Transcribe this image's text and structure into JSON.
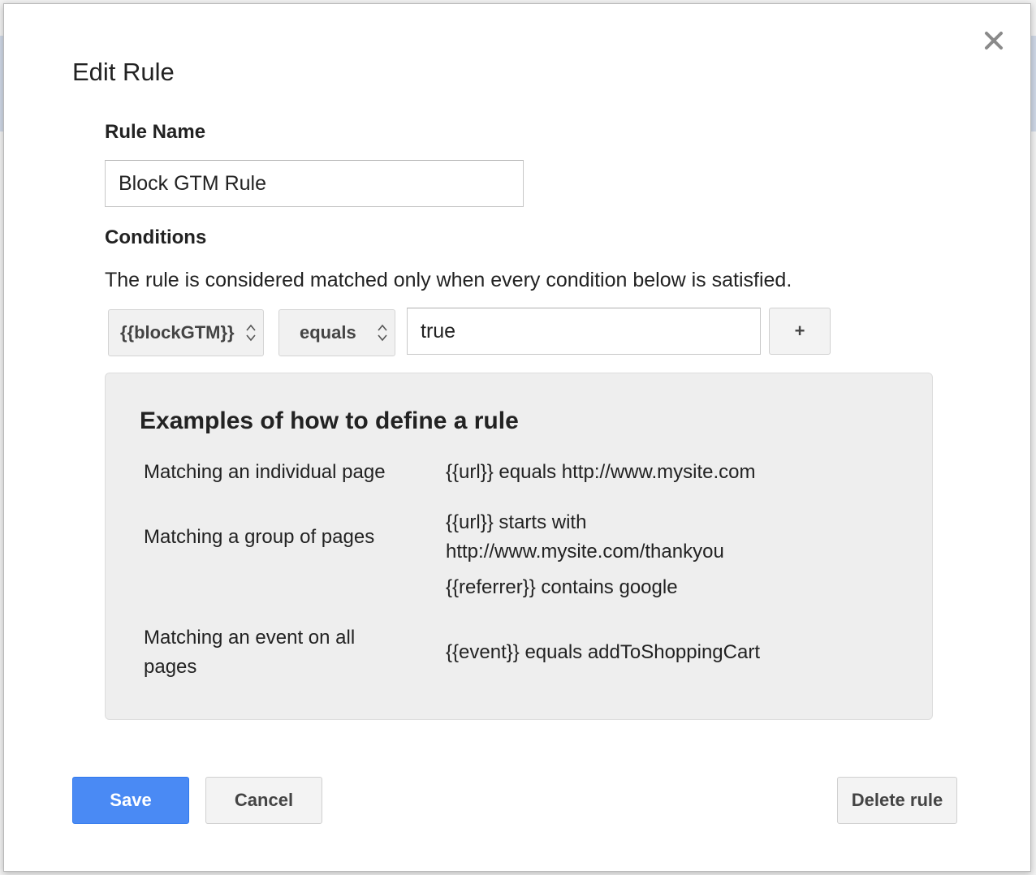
{
  "dialog": {
    "title": "Edit Rule",
    "close_icon": "close-icon"
  },
  "rule_name": {
    "label": "Rule Name",
    "value": "Block GTM Rule"
  },
  "conditions": {
    "label": "Conditions",
    "description": "The rule is considered matched only when every condition below is satisfied.",
    "variable_select": "{{blockGTM}}",
    "operator_select": "equals",
    "value": "true",
    "add_label": "+"
  },
  "examples": {
    "title": "Examples of how to define a rule",
    "rows": [
      {
        "label": "Matching an individual page",
        "examples": [
          "{{url}} equals http://www.mysite.com"
        ]
      },
      {
        "label": "Matching a group of pages",
        "examples": [
          "{{url}} starts with",
          "http://www.mysite.com/thankyou",
          "{{referrer}} contains google"
        ]
      },
      {
        "label_lines": [
          "Matching an event on all",
          "pages"
        ],
        "examples": [
          "{{event}} equals addToShoppingCart"
        ]
      }
    ]
  },
  "footer": {
    "save_label": "Save",
    "cancel_label": "Cancel",
    "delete_label": "Delete rule"
  },
  "colors": {
    "primary_button": "#4a8af4",
    "examples_background": "#eeeeee"
  }
}
